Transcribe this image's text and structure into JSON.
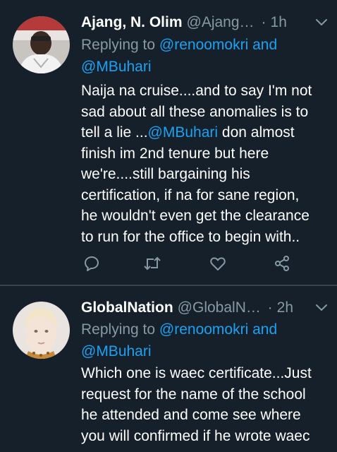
{
  "tweets": [
    {
      "name": "Ajang, N. Olim",
      "handle": "@Ajangvie...",
      "separator": "·",
      "time": "1h",
      "replying_prefix": "Replying to ",
      "reply_to_1": "@renoomokri and",
      "reply_to_2": "@MBuhari",
      "lines": {
        "l1": "Naija na cruise....and to say I'm not",
        "l2": "sad about all these anomalies is to",
        "l3a": "tell a lie ...",
        "l3_mention": "@MBuhari",
        "l3b": " don almost",
        "l4": "finish im 2nd tenure but here",
        "l5": "we're....still bargaining his",
        "l6": "certification, if na for sane region,",
        "l7": "he wouldn't even get the clearance",
        "l8": "to  run for the office to begin with.."
      }
    },
    {
      "name": "GlobalNation",
      "handle": "@GlobalNati...",
      "separator": "·",
      "time": "2h",
      "replying_prefix": "Replying to ",
      "reply_to_1": "@renoomokri and",
      "reply_to_2": "@MBuhari",
      "lines": {
        "l1": "Which one is waec certificate...Just",
        "l2": "request for the name of the school",
        "l3": "he attended and come see where",
        "l4": "you will confirmed if he wrote waec"
      }
    }
  ],
  "icons": {
    "more": "chevron-down-icon",
    "reply": "reply-icon",
    "retweet": "retweet-icon",
    "like": "like-icon",
    "share": "share-icon"
  },
  "colors": {
    "background": "#15202b",
    "secondary_text": "#8899a6",
    "link": "#1da1f2",
    "divider": "#38444d"
  }
}
